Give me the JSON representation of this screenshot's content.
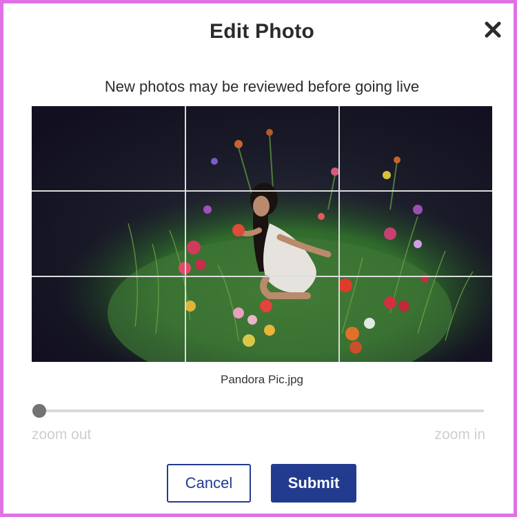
{
  "dialog": {
    "title": "Edit Photo",
    "subtitle": "New photos may be reviewed before going live",
    "close_icon": "close-icon"
  },
  "photo": {
    "file_name": "Pandora Pic.jpg",
    "description_icon": "photo-crop-area",
    "grid_lines": "3x3"
  },
  "zoom": {
    "min_label": "zoom out",
    "max_label": "zoom in",
    "level": 0
  },
  "actions": {
    "cancel_label": "Cancel",
    "submit_label": "Submit"
  },
  "colors": {
    "frame_border": "#e070e6",
    "primary": "#233b8f",
    "slider_thumb": "#737373",
    "slider_track": "#d9d9d9",
    "muted_text": "#cfcfcf"
  }
}
